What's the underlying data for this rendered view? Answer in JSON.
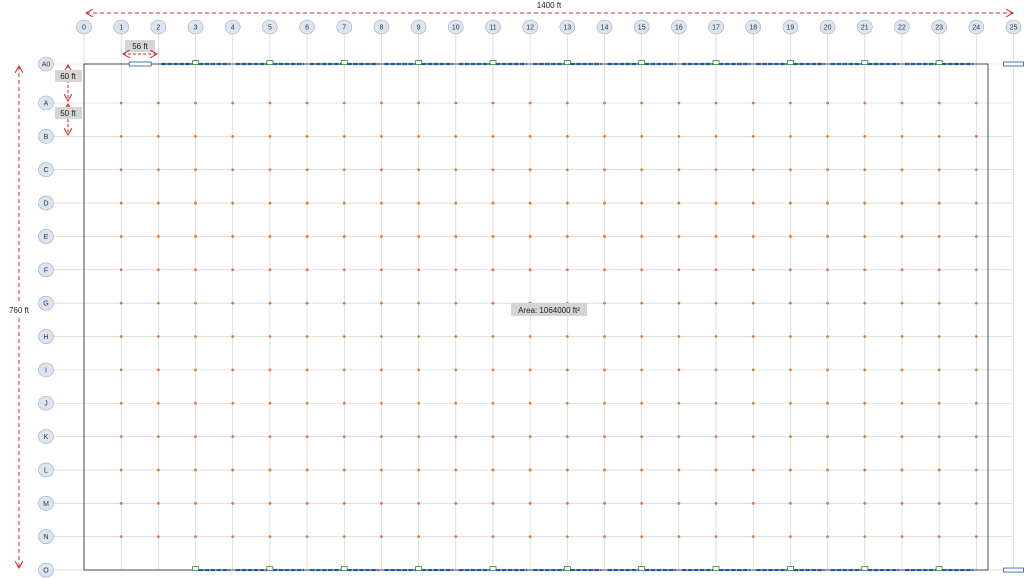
{
  "columns": [
    "0",
    "1",
    "2",
    "3",
    "4",
    "5",
    "6",
    "7",
    "8",
    "9",
    "10",
    "11",
    "12",
    "13",
    "14",
    "15",
    "16",
    "17",
    "18",
    "19",
    "20",
    "21",
    "22",
    "23",
    "24",
    "25"
  ],
  "rows": [
    "A0",
    "A",
    "B",
    "C",
    "D",
    "E",
    "F",
    "G",
    "H",
    "I",
    "J",
    "K",
    "L",
    "M",
    "N",
    "O"
  ],
  "dimensions": {
    "total_width": "1400 ft",
    "total_height": "760 ft",
    "bay_width": "56 ft",
    "first_row_spacing": "60 ft",
    "typical_row_spacing": "50 ft",
    "area_label": "Area: 1064000 ft²"
  },
  "colors": {
    "grid_line": "#cccccc",
    "bubble_fill": "#dbe5f1",
    "bubble_stroke": "#9aaabb",
    "column_dot": "#e07a2e",
    "dimension": "#d62728",
    "dim_label_bg": "#d5d5d5",
    "dock_door": "#1f5a9e",
    "dock_marker": "#2e8b2e",
    "building_outline": "#222222"
  }
}
